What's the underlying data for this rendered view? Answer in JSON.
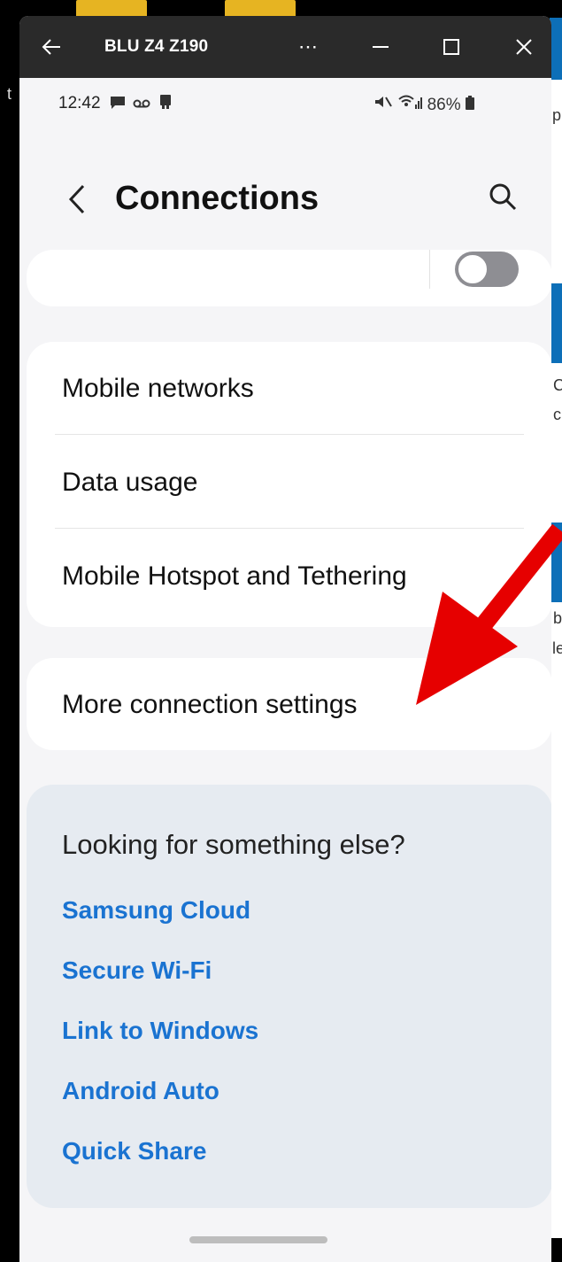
{
  "window": {
    "title": "BLU Z4 Z190",
    "dots": "⋯"
  },
  "status_bar": {
    "time": "12:42",
    "left_icons": "■ ∞ ■",
    "right_icons": "✖ ≉ ",
    "battery": "86%"
  },
  "header": {
    "title": "Connections"
  },
  "connections_list": [
    {
      "label": "Mobile networks"
    },
    {
      "label": "Data usage"
    },
    {
      "label": "Mobile Hotspot and Tethering"
    }
  ],
  "more_settings": {
    "label": "More connection settings"
  },
  "looking_for": {
    "title": "Looking for something else?",
    "links": [
      "Samsung Cloud",
      "Secure Wi-Fi",
      "Link to Windows",
      "Android Auto",
      "Quick Share"
    ]
  },
  "background_letters": [
    "t",
    "p",
    "C",
    "c",
    "b",
    "le"
  ],
  "colors": {
    "accent_link": "#1a73d1",
    "arrow": "#e60000",
    "titlebar": "#2a2a2a"
  }
}
